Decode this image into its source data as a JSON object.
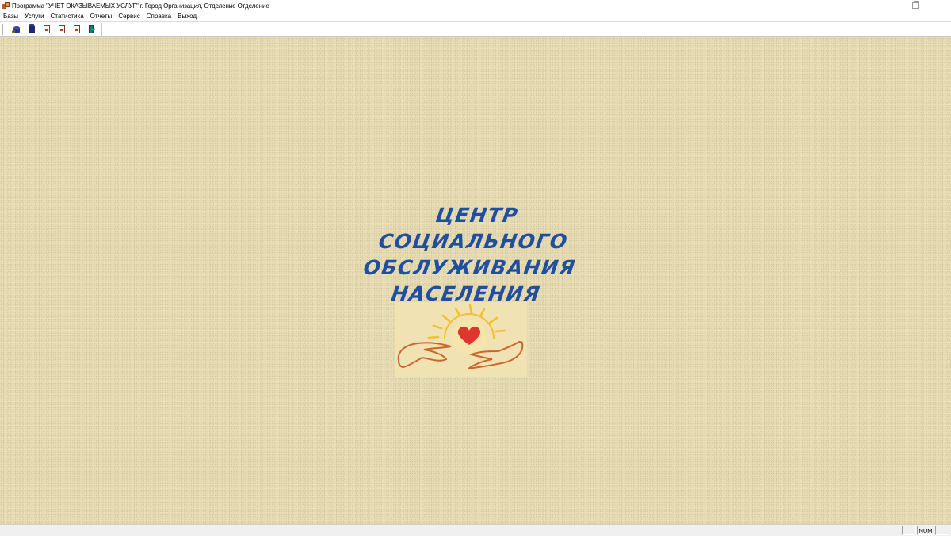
{
  "window": {
    "title": "Программа \"УЧЕТ ОКАЗЫВАЕМЫХ УСЛУГ\" г. Город Организация, Отделение Отделение"
  },
  "menu": {
    "items": [
      {
        "label": "Базы"
      },
      {
        "label": "Услуги"
      },
      {
        "label": "Статистика"
      },
      {
        "label": "Отчеты"
      },
      {
        "label": "Сервис"
      },
      {
        "label": "Справка"
      },
      {
        "label": "Выход"
      }
    ]
  },
  "toolbar": {
    "buttons": [
      {
        "icon": "database-key-icon"
      },
      {
        "icon": "jar-icon"
      },
      {
        "icon": "report-doc-icon"
      },
      {
        "icon": "report-doc-icon"
      },
      {
        "icon": "report-doc-icon"
      },
      {
        "icon": "exit-door-icon"
      }
    ]
  },
  "main": {
    "logo_lines": [
      "ЦЕНТР",
      "СОЦИАЛЬНОГО",
      "ОБСЛУЖИВАНИЯ",
      "НАСЕЛЕНИЯ"
    ],
    "emblem": "hands-sun-heart-emblem",
    "colors": {
      "background": "#e6dbb2",
      "logo_text": "#1f4f9e",
      "heart": "#e0342f",
      "sun": "#f2c12e",
      "hands": "#c8672a"
    }
  },
  "statusbar": {
    "num_indicator": "NUM"
  }
}
